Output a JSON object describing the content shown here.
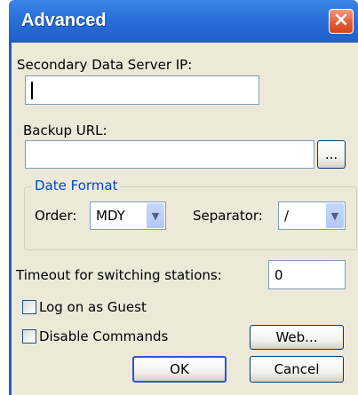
{
  "window": {
    "title": "Advanced",
    "close_icon": "close-icon"
  },
  "fields": {
    "secondary_ip_label": "Secondary Data Server IP:",
    "secondary_ip_value": "",
    "backup_url_label": "Backup URL:",
    "backup_url_value": "",
    "browse_button": "..."
  },
  "date_format": {
    "group_title": "Date Format",
    "order_label": "Order:",
    "order_value": "MDY",
    "separator_label": "Separator:",
    "separator_value": "/"
  },
  "timeout": {
    "label": "Timeout for switching stations:",
    "value": "0"
  },
  "options": {
    "log_on_guest": "Log on as Guest",
    "log_on_guest_checked": false,
    "disable_commands": "Disable Commands",
    "disable_commands_checked": false
  },
  "buttons": {
    "web": "Web...",
    "ok": "OK",
    "cancel": "Cancel"
  },
  "colors": {
    "titlebar": "#2a6fd8",
    "dialog_bg": "#ece9d8",
    "group_title": "#0046d5",
    "close_button": "#e35a34"
  }
}
